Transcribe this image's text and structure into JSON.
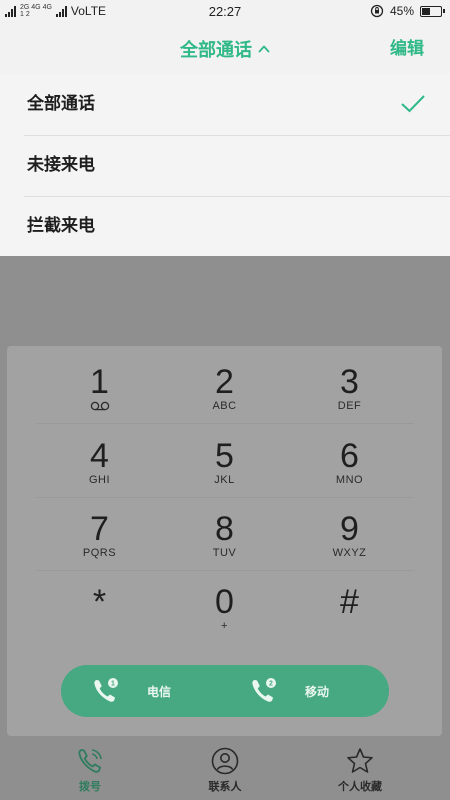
{
  "status_bar": {
    "network_top": "2G 4G 4G",
    "network_bottom": "1 2",
    "carrier_label": "VoLTE",
    "time": "22:27",
    "battery_percent": "45%",
    "battery_level": 0.45
  },
  "header": {
    "title": "全部通话",
    "edit_label": "编辑"
  },
  "filter_menu": {
    "items": [
      {
        "label": "全部通话",
        "selected": true
      },
      {
        "label": "未接来电",
        "selected": false
      },
      {
        "label": "拦截来电",
        "selected": false
      }
    ]
  },
  "keypad": {
    "keys": [
      {
        "digit": "1",
        "letters": "",
        "icon": "voicemail-icon"
      },
      {
        "digit": "2",
        "letters": "ABC"
      },
      {
        "digit": "3",
        "letters": "DEF"
      },
      {
        "digit": "4",
        "letters": "GHI"
      },
      {
        "digit": "5",
        "letters": "JKL"
      },
      {
        "digit": "6",
        "letters": "MNO"
      },
      {
        "digit": "7",
        "letters": "PQRS"
      },
      {
        "digit": "8",
        "letters": "TUV"
      },
      {
        "digit": "9",
        "letters": "WXYZ"
      },
      {
        "digit": "*",
        "letters": ""
      },
      {
        "digit": "0",
        "letters": "+"
      },
      {
        "digit": "#",
        "letters": ""
      }
    ]
  },
  "call_buttons": {
    "sim1_number": "1",
    "sim1_label": "电信",
    "sim2_number": "2",
    "sim2_label": "移动"
  },
  "bottom_nav": {
    "items": [
      {
        "label": "拨号",
        "icon": "phone-icon",
        "active": true
      },
      {
        "label": "联系人",
        "icon": "contact-icon",
        "active": false
      },
      {
        "label": "个人收藏",
        "icon": "star-icon",
        "active": false
      }
    ]
  },
  "colors": {
    "accent": "#2fb888",
    "call_button": "#47a982",
    "dim_overlay": "#8f8f8f"
  }
}
